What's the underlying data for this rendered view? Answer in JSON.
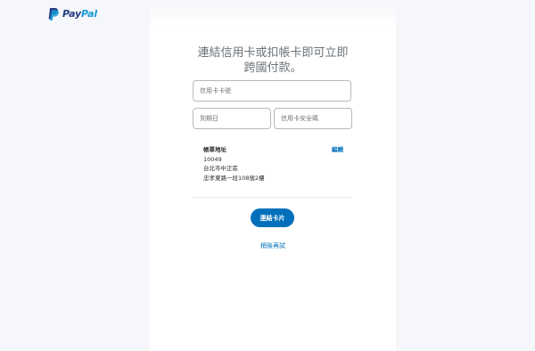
{
  "brand": {
    "name_part1": "Pay",
    "name_part2": "Pal",
    "color_dark": "#253b80",
    "color_light": "#179bd7"
  },
  "form": {
    "title": "連結信用卡或扣帳卡即可立即跨國付款。",
    "card_number": {
      "placeholder": "信用卡卡號",
      "value": ""
    },
    "expiry": {
      "placeholder": "到期日",
      "value": ""
    },
    "cvv": {
      "placeholder": "信用卡安全碼",
      "value": ""
    }
  },
  "billing": {
    "label": "帳單地址",
    "lines": [
      "10049",
      "台北市中正區",
      "忠孝東路一段108號2樓"
    ],
    "edit_label": "編輯"
  },
  "actions": {
    "submit_label": "連結卡片",
    "later_label": "稍後再試",
    "accent_color": "#0070ba"
  }
}
